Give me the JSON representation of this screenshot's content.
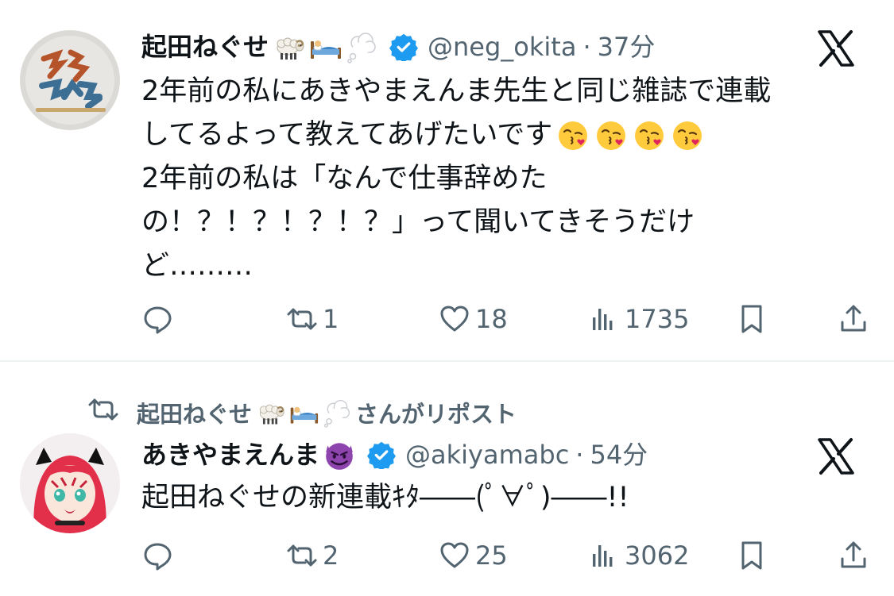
{
  "tweets": [
    {
      "author": {
        "display_name": "起田ねぐせ",
        "name_emojis": [
          "sheep",
          "bed",
          "thought-balloon"
        ],
        "handle": "@neg_okita",
        "verified": true
      },
      "time": "37分",
      "separator": "·",
      "body_lines": [
        "2年前の私にあきやまえんま先生と同じ雑誌で連載",
        "してるよって教えてあげたいです",
        "2年前の私は「なんで仕事辞めた",
        "の！？！？！？！？」って聞いてきそうだけ",
        "ど………"
      ],
      "body_emojis": [
        "face-blowing-kiss",
        "face-blowing-kiss",
        "face-blowing-kiss",
        "face-blowing-kiss"
      ],
      "stats": {
        "replies": "",
        "reposts": "1",
        "likes": "18",
        "views": "1735"
      }
    },
    {
      "repost_banner": {
        "reposter": "起田ねぐせ",
        "reposter_emojis": [
          "sheep",
          "bed",
          "thought-balloon"
        ],
        "label": "さんがリポスト"
      },
      "author": {
        "display_name": "あきやまえんま",
        "name_emojis": [
          "smiling-face-with-horns"
        ],
        "handle": "@akiyamabc",
        "verified": true
      },
      "time": "54分",
      "separator": "·",
      "body_lines": [
        "起田ねぐせの新連載ｷﾀ――(ﾟ∀ﾟ)――!!"
      ],
      "stats": {
        "replies": "",
        "reposts": "2",
        "likes": "25",
        "views": "3062"
      }
    }
  ],
  "icons": {
    "logo": "x-logo-icon",
    "reply": "reply-icon",
    "repost": "repost-icon",
    "like": "heart-icon",
    "views": "views-chart-icon",
    "bookmark": "bookmark-icon",
    "share": "share-icon",
    "verified": "verified-badge-icon"
  },
  "colors": {
    "text": "#0f1419",
    "secondary": "#536471",
    "verified_blue": "#1d9bf0",
    "divider": "#eff3f4"
  }
}
